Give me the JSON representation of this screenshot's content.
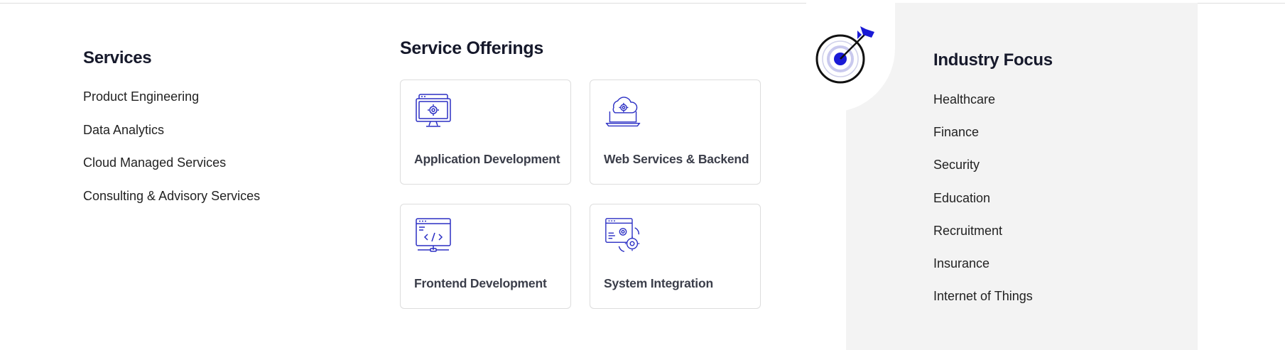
{
  "services": {
    "heading": "Services",
    "items": [
      {
        "label": "Product Engineering"
      },
      {
        "label": "Data Analytics"
      },
      {
        "label": "Cloud Managed Services"
      },
      {
        "label": "Consulting & Advisory Services"
      }
    ]
  },
  "offerings": {
    "heading": "Service Offerings",
    "cards": [
      {
        "label": "Application Development",
        "icon": "monitor-gear-icon"
      },
      {
        "label": "Web Services & Backend",
        "icon": "cloud-laptop-icon"
      },
      {
        "label": "Frontend Development",
        "icon": "code-monitor-icon"
      },
      {
        "label": "System Integration",
        "icon": "window-gears-icon"
      }
    ]
  },
  "industry": {
    "heading": "Industry Focus",
    "items": [
      {
        "label": "Healthcare"
      },
      {
        "label": "Finance"
      },
      {
        "label": "Security"
      },
      {
        "label": "Education"
      },
      {
        "label": "Recruitment"
      },
      {
        "label": "Insurance"
      },
      {
        "label": "Internet of Things"
      }
    ]
  },
  "theme": {
    "icon_color": "#2b2fc4",
    "accent": "#1a1ad6",
    "panel_bg": "#f3f3f3",
    "heading_color": "#16192b"
  }
}
